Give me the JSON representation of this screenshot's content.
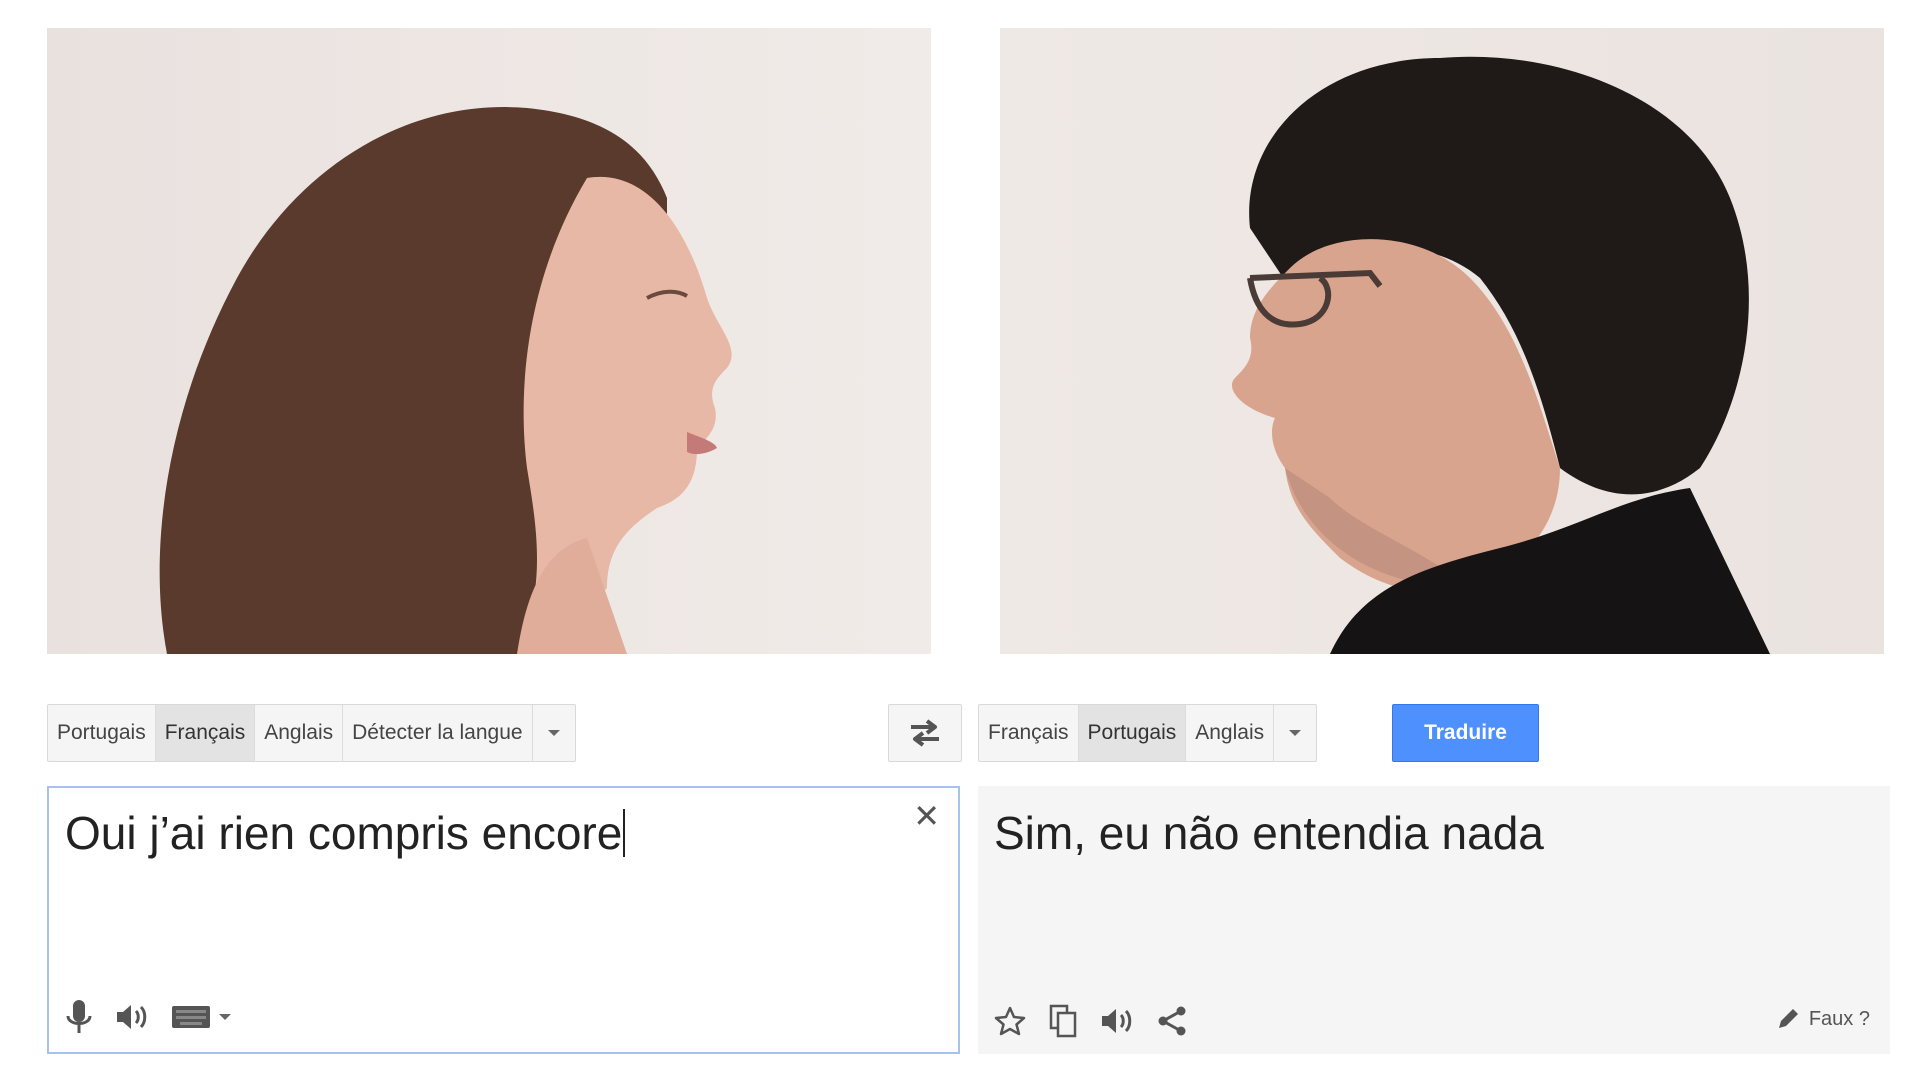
{
  "source_languages": [
    {
      "label": "Portugais",
      "active": false
    },
    {
      "label": "Français",
      "active": true
    },
    {
      "label": "Anglais",
      "active": false
    },
    {
      "label": "Détecter la langue",
      "active": false
    }
  ],
  "target_languages": [
    {
      "label": "Français",
      "active": false
    },
    {
      "label": "Portugais",
      "active": true
    },
    {
      "label": "Anglais",
      "active": false
    }
  ],
  "translate_button": "Traduire",
  "source_text": "Oui j’ai rien compris encore",
  "translated_text": "Sim, eu não entendia nada",
  "wrong_label": "Faux ?",
  "source_tools": [
    "microphone-icon",
    "speaker-icon",
    "keyboard-icon",
    "chevron-down-icon"
  ],
  "target_tools": [
    "star-icon",
    "copy-icon",
    "speaker-icon",
    "share-icon"
  ],
  "colors": {
    "accent": "#4d90fe",
    "input_border": "#a7c2ee",
    "output_bg": "#f5f5f5"
  }
}
